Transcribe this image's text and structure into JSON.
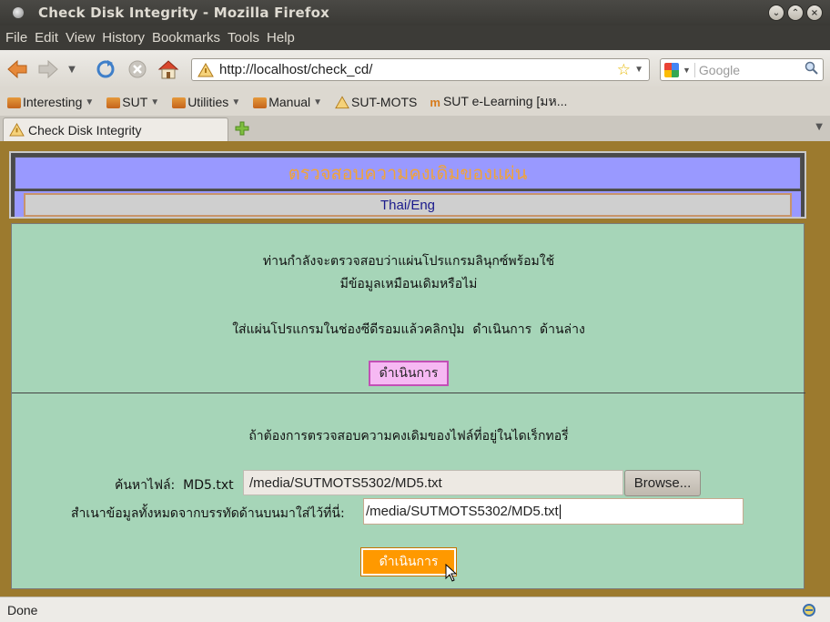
{
  "window": {
    "title": "Check Disk Integrity - Mozilla Firefox"
  },
  "menu": {
    "file": "File",
    "edit": "Edit",
    "view": "View",
    "history": "History",
    "bookmarks": "Bookmarks",
    "tools": "Tools",
    "help": "Help"
  },
  "nav": {
    "url": "http://localhost/check_cd/",
    "search_placeholder": "Google"
  },
  "bookmarks": [
    {
      "label": "Interesting"
    },
    {
      "label": "SUT"
    },
    {
      "label": "Utilities"
    },
    {
      "label": "Manual"
    },
    {
      "label": "SUT-MOTS"
    },
    {
      "label": "SUT e-Learning [มห..."
    }
  ],
  "tab": {
    "label": "Check Disk Integrity"
  },
  "page": {
    "title": "ตรวจสอบความคงเดิมของแผ่น",
    "lang_toggle": "Thai/Eng",
    "intro_line1": "ท่านกำลังจะตรวจสอบว่าแผ่นโปรแกรมลินุกซ์พร้อมใช้",
    "intro_line2": "มีข้อมูลเหมือนเดิมหรือไม่",
    "instruction": "ใส่แผ่นโปรแกรมในช่องซีดีรอมแล้วคลิกปุ่ม  ดำเนินการ  ด้านล่าง",
    "run_button_1": "ดำเนินการ",
    "dir_check_text": "ถ้าต้องการตรวจสอบความคงเดิมของไฟล์ที่อยู่ในไดเร็กทอรี่",
    "find_file_label": "ค้นหาไฟล์:  MD5.txt",
    "file_input_value": "/media/SUTMOTS5302/MD5.txt",
    "browse_button": "Browse...",
    "copy_label": "สำเนาข้อมูลทั้งหมดจากบรรทัดด้านบนมาใส่ไว้ที่นี่:",
    "path_input_value": "/media/SUTMOTS5302/MD5.txt",
    "run_button_2": "ดำเนินการ"
  },
  "status": {
    "text": "Done"
  }
}
